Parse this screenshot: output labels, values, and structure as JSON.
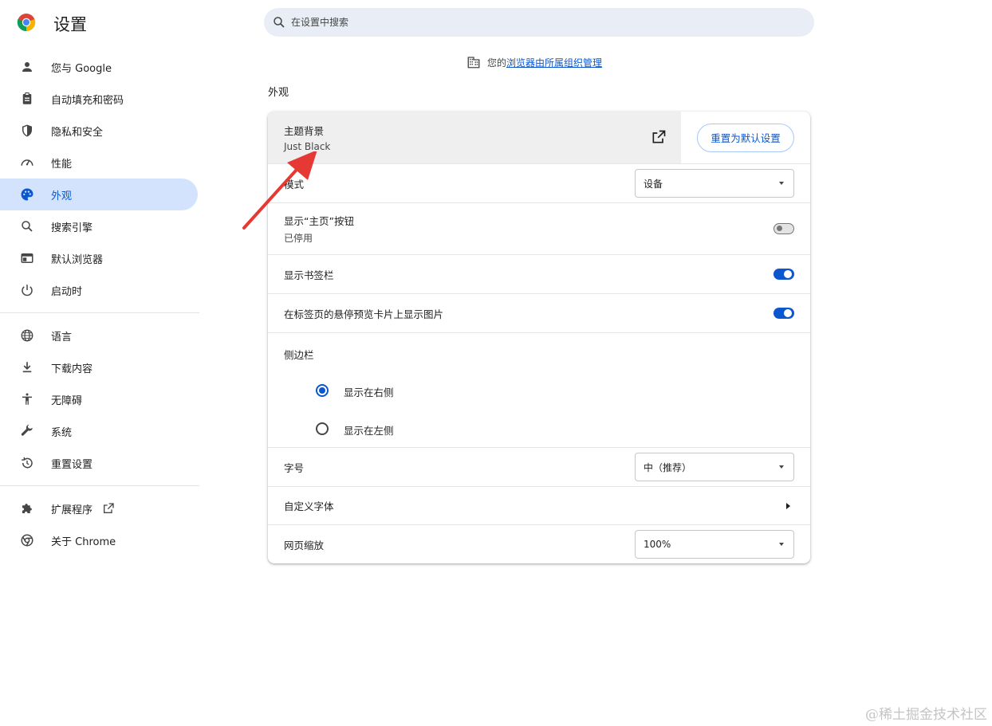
{
  "app": {
    "title": "设置"
  },
  "search": {
    "placeholder": "在设置中搜索"
  },
  "sidebar": {
    "items": [
      {
        "label": "您与 Google",
        "icon": "person-icon"
      },
      {
        "label": "自动填充和密码",
        "icon": "clipboard-icon"
      },
      {
        "label": "隐私和安全",
        "icon": "shield-icon"
      },
      {
        "label": "性能",
        "icon": "speedometer-icon"
      },
      {
        "label": "外观",
        "icon": "palette-icon",
        "active": true
      },
      {
        "label": "搜索引擎",
        "icon": "search-icon"
      },
      {
        "label": "默认浏览器",
        "icon": "browser-icon"
      },
      {
        "label": "启动时",
        "icon": "power-icon"
      }
    ],
    "items2": [
      {
        "label": "语言",
        "icon": "globe-icon"
      },
      {
        "label": "下载内容",
        "icon": "download-icon"
      },
      {
        "label": "无障碍",
        "icon": "accessibility-icon"
      },
      {
        "label": "系统",
        "icon": "wrench-icon"
      },
      {
        "label": "重置设置",
        "icon": "history-icon"
      }
    ],
    "items3": [
      {
        "label": "扩展程序",
        "icon": "puzzle-icon"
      },
      {
        "label": "关于 Chrome",
        "icon": "chrome-icon"
      }
    ]
  },
  "managed": {
    "prefix": "您的",
    "link": "浏览器由所属组织管理"
  },
  "section": {
    "title": "外观"
  },
  "appearance": {
    "theme": {
      "label": "主题背景",
      "value": "Just Black",
      "reset_label": "重置为默认设置"
    },
    "mode": {
      "label": "模式",
      "select_value": "设备"
    },
    "home_button": {
      "label": "显示“主页”按钮",
      "sub": "已停用",
      "enabled": false
    },
    "bookmarks_bar": {
      "label": "显示书签栏",
      "enabled": true
    },
    "hover_card": {
      "label": "在标签页的悬停预览卡片上显示图片",
      "enabled": true
    },
    "side_panel": {
      "label": "侧边栏",
      "options": [
        "显示在右侧",
        "显示在左侧"
      ],
      "selected": "显示在右侧"
    },
    "font_size": {
      "label": "字号",
      "select_value": "中（推荐）"
    },
    "custom_fonts": {
      "label": "自定义字体"
    },
    "page_zoom": {
      "label": "网页缩放",
      "select_value": "100%"
    }
  },
  "watermark": "@稀土掘金技术社区",
  "colors": {
    "accent": "#0b57d0",
    "active_bg": "#d3e3fd",
    "arrow": "#e53935"
  }
}
